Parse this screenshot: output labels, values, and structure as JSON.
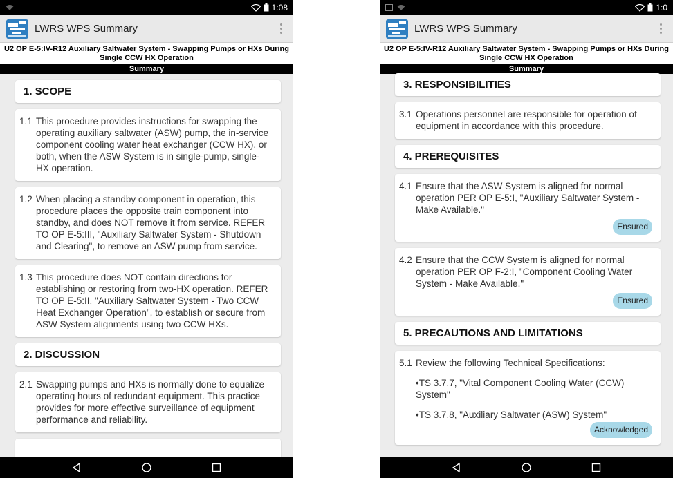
{
  "left": {
    "status_time": "1:08",
    "app_title": "LWRS WPS Summary",
    "procedure_title": "U2 OP E-5:IV-R12 Auxiliary Saltwater System - Swapping Pumps or HXs During Single CCW HX Operation",
    "summary_label": "Summary",
    "sections": [
      {
        "title": "1. SCOPE"
      },
      {
        "title": "2. DISCUSSION"
      }
    ],
    "steps": [
      {
        "num": "1.1",
        "text": "This procedure provides instructions for swapping the operating auxiliary saltwater (ASW) pump, the in-service component cooling water heat exchanger (CCW HX), or both, when the ASW System is in single-pump, single-HX operation."
      },
      {
        "num": "1.2",
        "text": "When placing a standby component in operation, this procedure places the opposite train component into standby, and does NOT remove it from service. REFER TO OP E-5:III, \"Auxiliary Saltwater System - Shutdown and Clearing\", to remove an ASW pump from service."
      },
      {
        "num": "1.3",
        "text": "This procedure does NOT contain directions for establishing or restoring from two-HX operation. REFER TO OP E-5:II, \"Auxiliary Saltwater System - Two CCW Heat Exchanger Operation\", to establish or secure from ASW System alignments using two CCW HXs."
      },
      {
        "num": "2.1",
        "text": "Swapping pumps and HXs is normally done to equalize operating hours of redundant equipment. This practice provides for more effective surveillance of equipment performance and reliability."
      }
    ]
  },
  "right": {
    "status_time": "1:0",
    "app_title": "LWRS WPS Summary",
    "procedure_title": "U2 OP E-5:IV-R12 Auxiliary Saltwater System - Swapping Pumps or HXs During Single CCW HX Operation",
    "summary_label": "Summary",
    "sections": [
      {
        "title": "3. RESPONSIBILITIES"
      },
      {
        "title": "4. PREREQUISITES"
      },
      {
        "title": "5. PRECAUTIONS AND LIMITATIONS"
      }
    ],
    "steps": [
      {
        "num": "3.1",
        "text": "Operations personnel are responsible for operation of equipment in accordance with this procedure."
      },
      {
        "num": "4.1",
        "text": "Ensure that the ASW System is aligned for normal operation PER OP E-5:I, \"Auxiliary Saltwater System - Make Available.\"",
        "badge": "Ensured"
      },
      {
        "num": "4.2",
        "text": "Ensure that the CCW System is aligned for normal operation PER OP F-2:I, \"Component Cooling Water System - Make Available.\"",
        "badge": "Ensured"
      },
      {
        "num": "5.1",
        "text": "Review the following Technical Specifications:",
        "sub1": "•TS 3.7.7, \"Vital Component Cooling Water (CCW) System\"",
        "sub2": "•TS 3.7.8, \"Auxiliary Saltwater (ASW) System\"",
        "badge": "Acknowledged"
      }
    ]
  },
  "colors": {
    "badge": "#a8d8e8",
    "background": "#ececec",
    "appbar": "#e9e9e9"
  },
  "icons": [
    "wifi-icon",
    "battery-icon",
    "app-logo-icon",
    "overflow-menu-icon",
    "back-icon",
    "home-icon",
    "recents-icon"
  ]
}
